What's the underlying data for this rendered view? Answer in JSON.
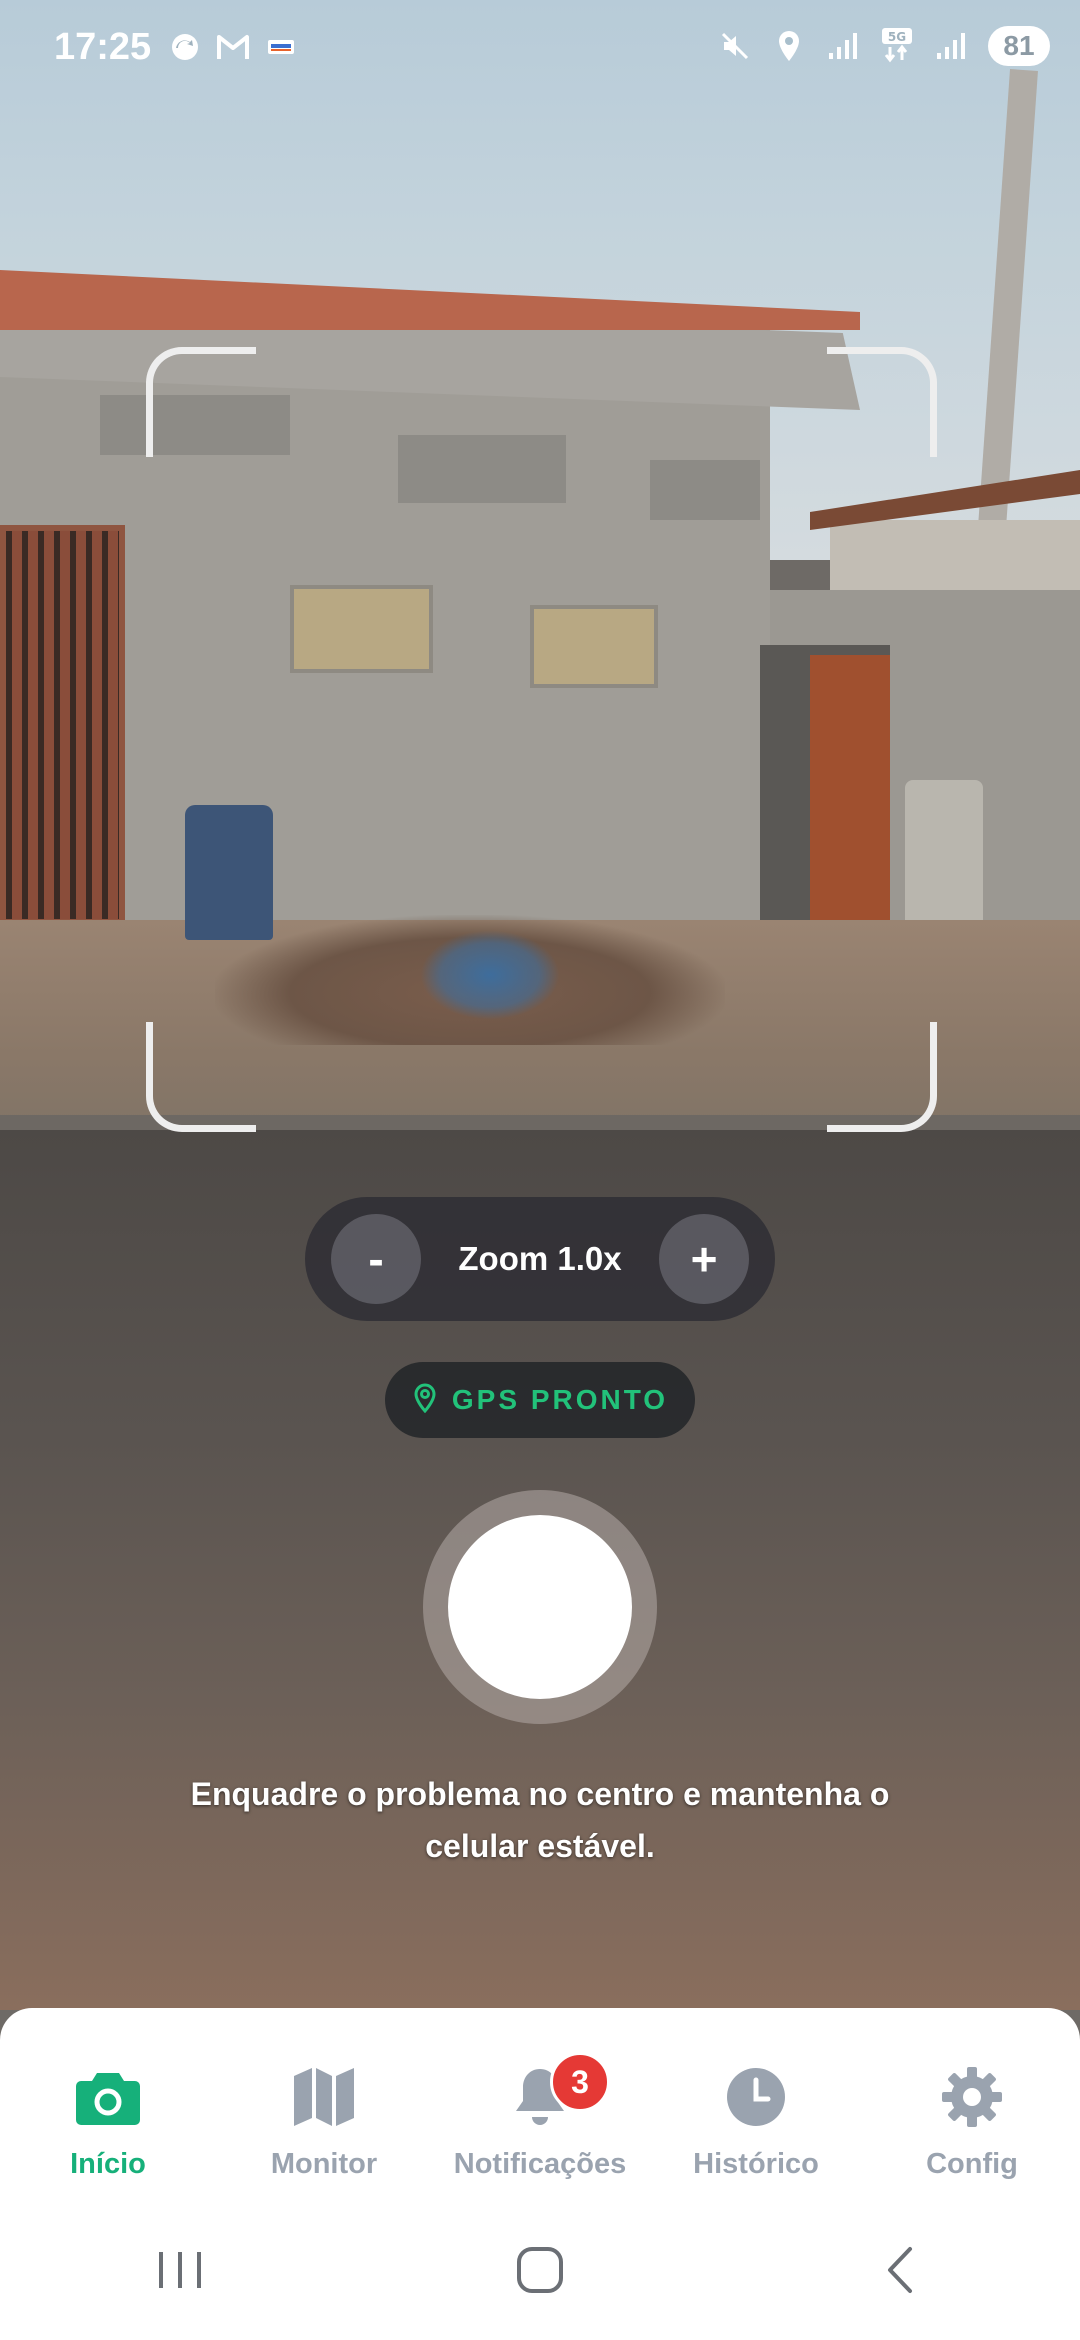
{
  "status_bar": {
    "time": "17:25",
    "battery": "81",
    "left_icons": [
      "sync-icon",
      "gmail-icon",
      "cpfl-app-icon"
    ],
    "right_icons": [
      "mute-icon",
      "location-icon",
      "signal-icon",
      "5g-signal-icon",
      "signal-icon-2"
    ]
  },
  "camera": {
    "zoom_label": "Zoom 1.0x",
    "zoom_out_label": "-",
    "zoom_in_label": "+",
    "gps_status": "GPS PRONTO",
    "hint": "Enquadre o problema no centro e mantenha o celular estável."
  },
  "nav": {
    "items": [
      {
        "label": "Início",
        "icon": "camera-icon",
        "active": true
      },
      {
        "label": "Monitor",
        "icon": "map-icon",
        "active": false
      },
      {
        "label": "Notificações",
        "icon": "bell-icon",
        "active": false,
        "badge": "3"
      },
      {
        "label": "Histórico",
        "icon": "clock-icon",
        "active": false
      },
      {
        "label": "Config",
        "icon": "gear-icon",
        "active": false
      }
    ]
  },
  "colors": {
    "accent": "#16b07a",
    "inactive": "#9aa3af",
    "badge": "#e53935",
    "gps_text": "#22c27a"
  }
}
